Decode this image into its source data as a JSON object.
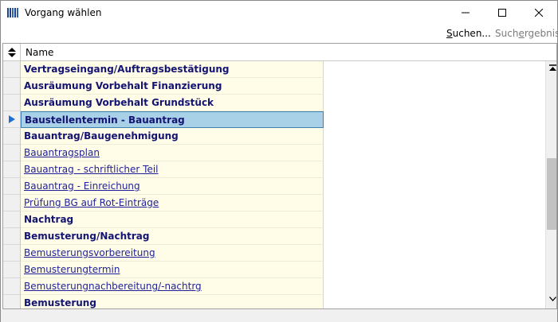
{
  "window": {
    "title": "Vorgang wählen",
    "icon": "books-icon"
  },
  "toolbar": {
    "search_label": "Suchen...",
    "search_mnemonic_pre": "S",
    "search_rest": "uchen...",
    "result_label": "Suchergebnis",
    "result_pre": "Such",
    "result_mnemonic": "e",
    "result_rest": "rgebnis"
  },
  "grid": {
    "column_header": "Name",
    "rows": [
      {
        "label": "Vertragseingang/Auftragsbestätigung",
        "style": "bold"
      },
      {
        "label": "Ausräumung Vorbehalt Finanzierung",
        "style": "bold"
      },
      {
        "label": "Ausräumung Vorbehalt Grundstück",
        "style": "bold"
      },
      {
        "label": "Baustellentermin - Bauantrag",
        "style": "bold",
        "selected": true
      },
      {
        "label": "Bauantrag/Baugenehmigung",
        "style": "bold"
      },
      {
        "label": "Bauantragsplan",
        "style": "link"
      },
      {
        "label": "Bauantrag - schriftlicher Teil",
        "style": "link"
      },
      {
        "label": "Bauantrag - Einreichung",
        "style": "link"
      },
      {
        "label": "Prüfung BG auf Rot-Einträge",
        "style": "link"
      },
      {
        "label": "Nachtrag",
        "style": "bold"
      },
      {
        "label": "Bemusterung/Nachtrag",
        "style": "bold"
      },
      {
        "label": "Bemusterungsvorbereitung",
        "style": "link"
      },
      {
        "label": "Bemusterungtermin",
        "style": "link"
      },
      {
        "label": "Bemusterungnachbereitung/-nachtrg",
        "style": "link"
      },
      {
        "label": "Bemusterung",
        "style": "bold"
      }
    ]
  },
  "colors": {
    "row_bg": "#fffde8",
    "selected_bg": "#a8d0e6",
    "text_dark_blue": "#141473",
    "selector_arrow": "#1f6fd6"
  }
}
